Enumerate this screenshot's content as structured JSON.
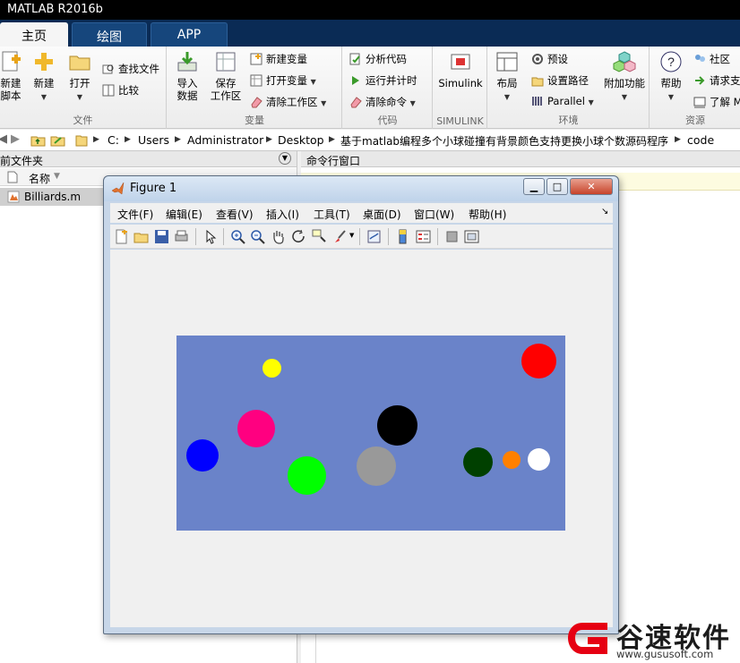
{
  "app": {
    "title": "MATLAB R2016b"
  },
  "tabs": [
    {
      "label": "主页"
    },
    {
      "label": "绘图"
    },
    {
      "label": "APP"
    }
  ],
  "ribbon": {
    "file": {
      "new_script": "新建\n脚本",
      "new": "新建",
      "open": "打开",
      "find_files": "查找文件",
      "compare": "比较",
      "group": "文件"
    },
    "variable": {
      "import": "导入\n数据",
      "save_ws": "保存\n工作区",
      "new_var": "新建变量",
      "open_var": "打开变量",
      "clear_ws": "清除工作区",
      "group": "变量"
    },
    "code": {
      "analyze": "分析代码",
      "run_time": "运行并计时",
      "clear_cmd": "清除命令",
      "group": "代码"
    },
    "simulink": {
      "label": "Simulink",
      "group": "SIMULINK"
    },
    "env": {
      "layout": "布局",
      "prefs": "预设",
      "set_path": "设置路径",
      "parallel": "Parallel",
      "addons": "附加功能",
      "group": "环境"
    },
    "resources": {
      "help": "帮助",
      "community": "社区",
      "request_support": "请求支",
      "learn": "了解 M",
      "group": "资源"
    }
  },
  "address": {
    "crumbs": [
      "C:",
      "Users",
      "Administrator",
      "Desktop",
      "基于matlab编程多个小球碰撞有背景颜色支持更换小球个数源码程序",
      "code"
    ]
  },
  "current_folder": {
    "title": "当前文件夹",
    "column_name": "名称",
    "files": [
      "Billiards.m"
    ]
  },
  "command_window": {
    "title": "命令行窗口"
  },
  "figure": {
    "title": "Figure 1",
    "menu": [
      "文件(F)",
      "编辑(E)",
      "查看(V)",
      "插入(I)",
      "工具(T)",
      "桌面(D)",
      "窗口(W)",
      "帮助(H)"
    ],
    "axes_color": "#6a83c9",
    "balls": [
      {
        "color": "#ffff00"
      },
      {
        "color": "#ff0000"
      },
      {
        "color": "#ff0080"
      },
      {
        "color": "#000000"
      },
      {
        "color": "#0000ff"
      },
      {
        "color": "#00ff00"
      },
      {
        "color": "#999999"
      },
      {
        "color": "#004000"
      },
      {
        "color": "#ff8000"
      },
      {
        "color": "#ffffff"
      }
    ]
  },
  "watermark": {
    "brand": "谷速软件",
    "url": "www.gususoft.com",
    "brand_color": "#e60012"
  }
}
